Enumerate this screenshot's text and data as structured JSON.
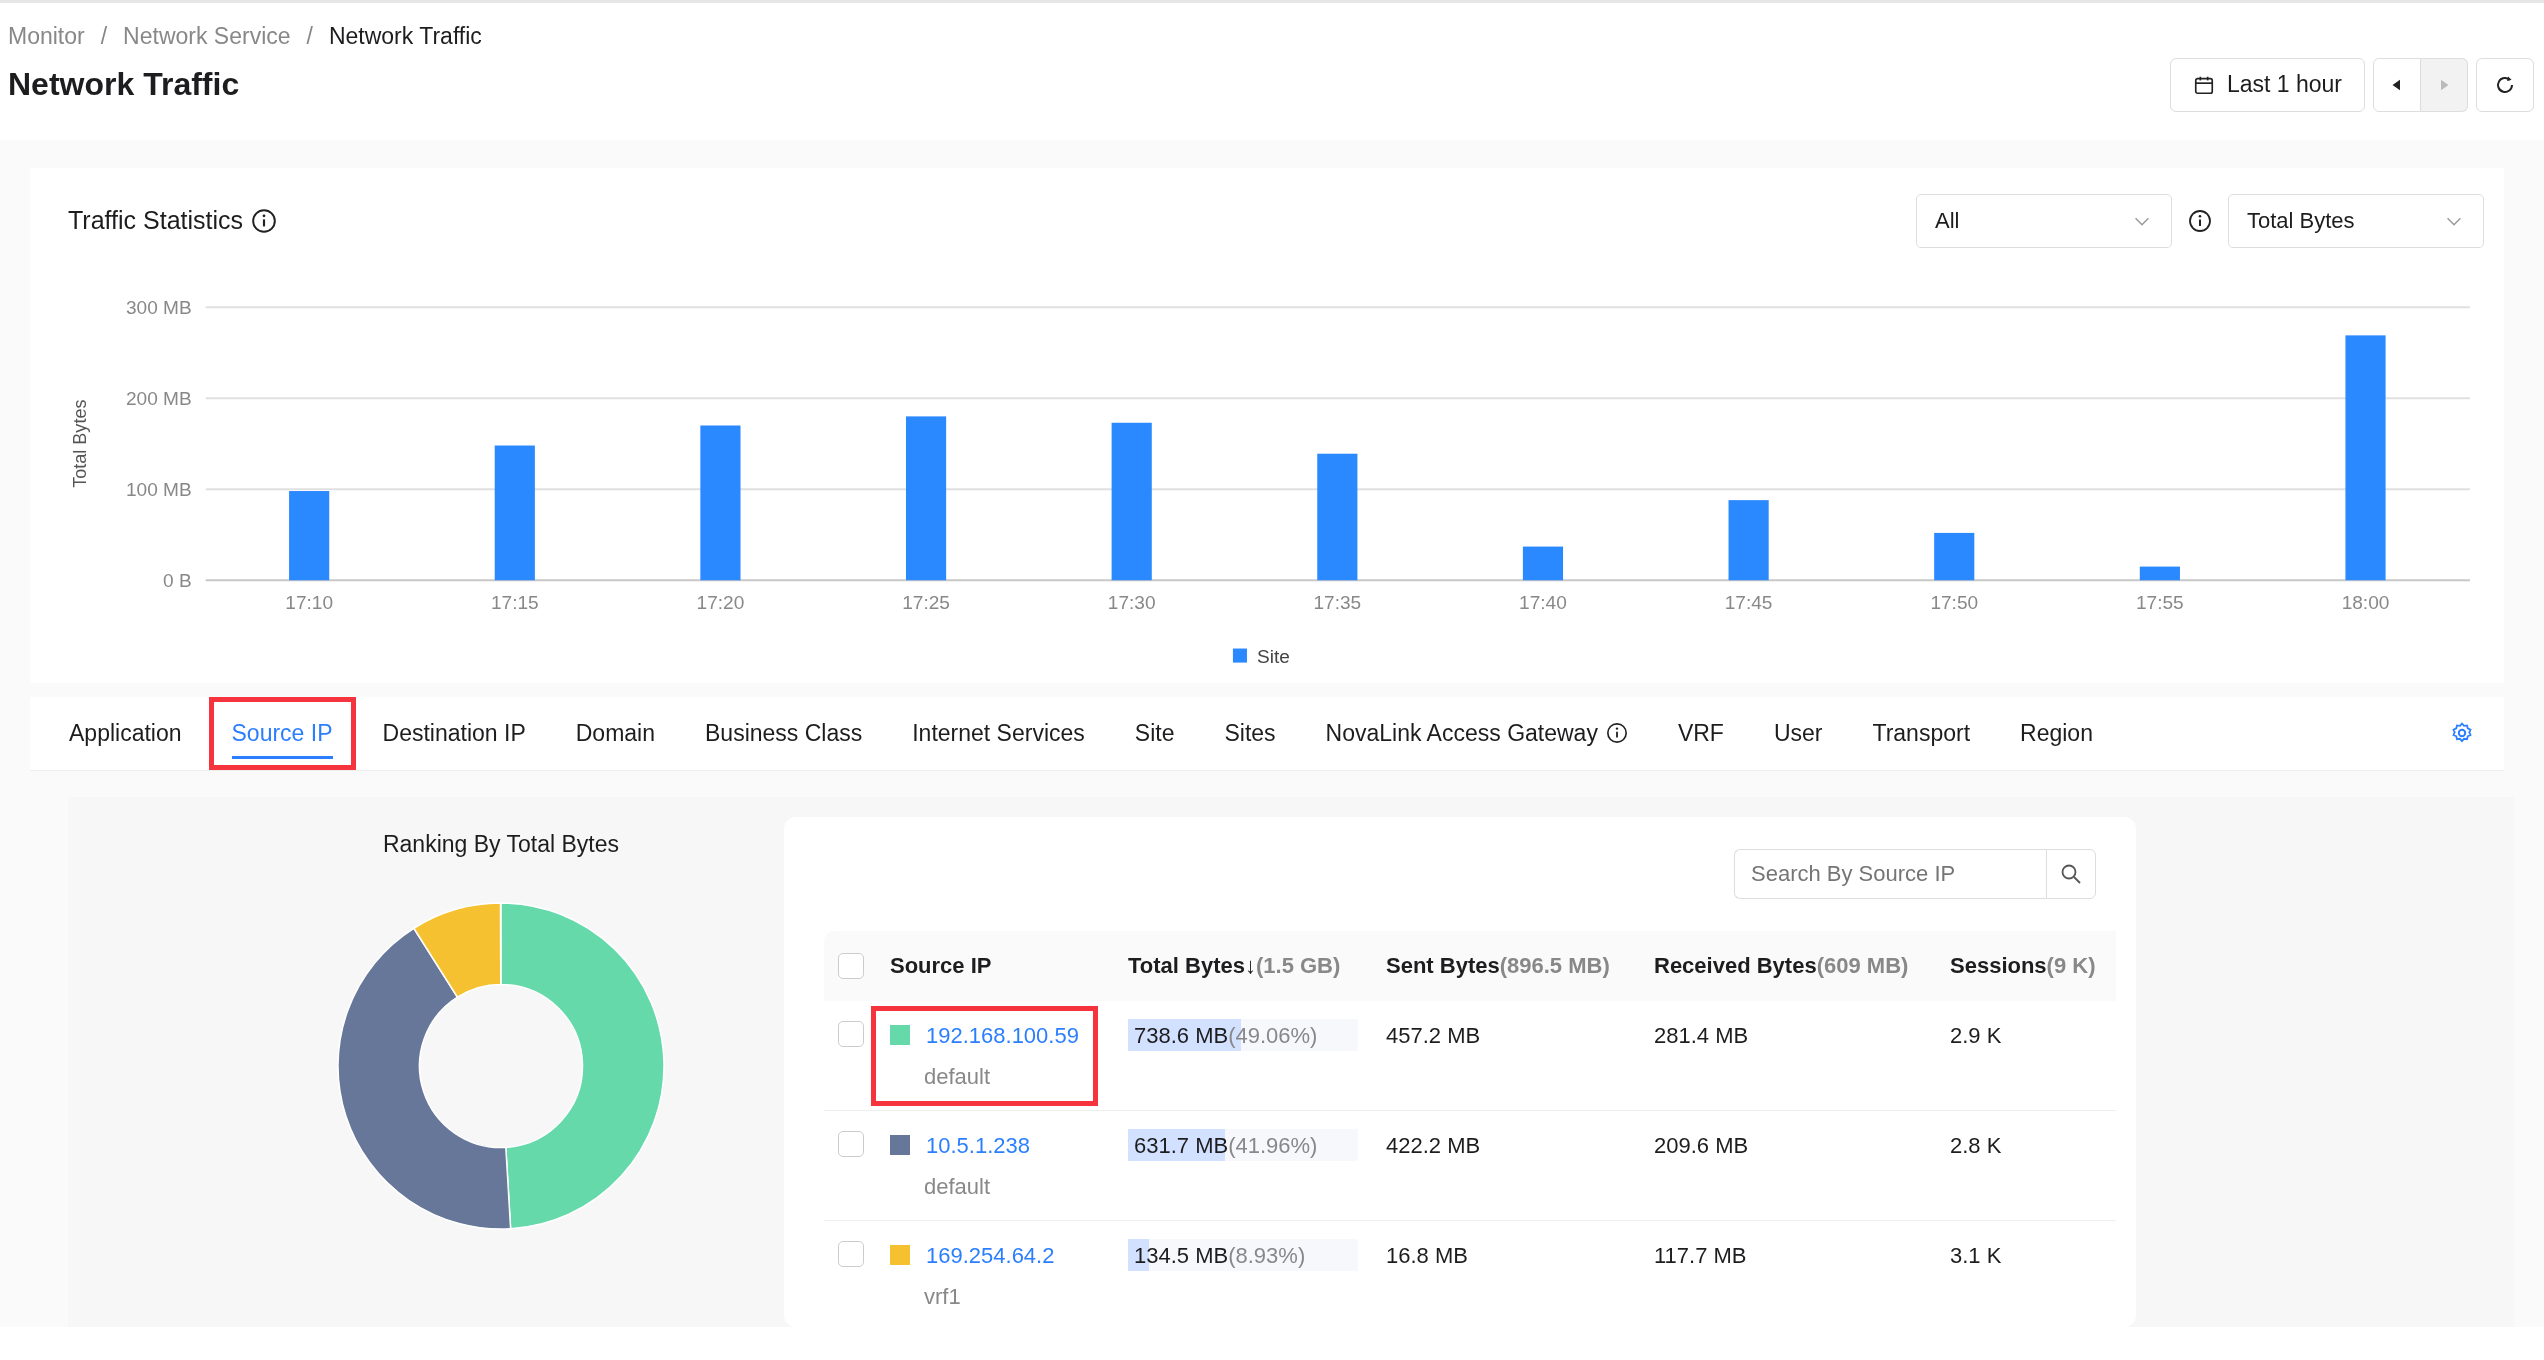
{
  "breadcrumb": [
    {
      "label": "Monitor",
      "current": false
    },
    {
      "label": "Network Service",
      "current": false
    },
    {
      "label": "Network Traffic",
      "current": true
    }
  ],
  "separator": "/",
  "title": "Network Traffic",
  "time_controls": {
    "range": "Last 1 hour",
    "prev_disabled": false,
    "next_disabled": true
  },
  "traffic_statistics": {
    "title": "Traffic Statistics",
    "filter": "All",
    "metric": "Total Bytes",
    "chart_data": {
      "type": "bar",
      "ylabel": "Total Bytes",
      "categories": [
        "17:10",
        "17:15",
        "17:20",
        "17:25",
        "17:30",
        "17:35",
        "17:40",
        "17:45",
        "17:50",
        "17:55",
        "18:00"
      ],
      "series": [
        {
          "name": "Site",
          "color": "#2b89ff",
          "values": [
            98,
            148,
            170,
            180,
            173,
            139,
            37,
            88,
            52,
            15,
            269
          ]
        }
      ],
      "ylim": [
        0,
        300
      ],
      "yticks": [
        {
          "value": 0,
          "label": "0 B"
        },
        {
          "value": 100,
          "label": "100 MB"
        },
        {
          "value": 200,
          "label": "200 MB"
        },
        {
          "value": 300,
          "label": "300 MB"
        }
      ]
    }
  },
  "tabs": [
    {
      "label": "Application",
      "selected": false,
      "info": false,
      "highlighted": false
    },
    {
      "label": "Source IP",
      "selected": true,
      "info": false,
      "highlighted": true
    },
    {
      "label": "Destination IP",
      "selected": false,
      "info": false,
      "highlighted": false
    },
    {
      "label": "Domain",
      "selected": false,
      "info": false,
      "highlighted": false
    },
    {
      "label": "Business Class",
      "selected": false,
      "info": false,
      "highlighted": false
    },
    {
      "label": "Internet Services",
      "selected": false,
      "info": false,
      "highlighted": false
    },
    {
      "label": "Site",
      "selected": false,
      "info": false,
      "highlighted": false
    },
    {
      "label": "Sites",
      "selected": false,
      "info": false,
      "highlighted": false
    },
    {
      "label": "NovaLink Access Gateway",
      "selected": false,
      "info": true,
      "highlighted": false
    },
    {
      "label": "VRF",
      "selected": false,
      "info": false,
      "highlighted": false
    },
    {
      "label": "User",
      "selected": false,
      "info": false,
      "highlighted": false
    },
    {
      "label": "Transport",
      "selected": false,
      "info": false,
      "highlighted": false
    },
    {
      "label": "Region",
      "selected": false,
      "info": false,
      "highlighted": false
    }
  ],
  "ranking": {
    "title": "Ranking By Total Bytes",
    "chart_data": {
      "type": "donut",
      "values": [
        49.06,
        41.96,
        8.93
      ]
    }
  },
  "table": {
    "search": {
      "placeholder": "Search By Source IP"
    },
    "select_all_checked": false,
    "columns": [
      {
        "label": "Source IP"
      },
      {
        "label": "Total Bytes",
        "sort": "↓",
        "total": "(1.5 GB)"
      },
      {
        "label": "Sent Bytes",
        "total": "(896.5 MB)"
      },
      {
        "label": "Received Bytes",
        "total": "(609 MB)"
      },
      {
        "label": "Sessions",
        "total": "(9 K)"
      }
    ],
    "rows": [
      {
        "checked": false,
        "color": "#66d9ab",
        "ip": "192.168.100.59",
        "vrf": "default",
        "highlighted": true,
        "total": "738.6 MB",
        "share": "(49.06%)",
        "level": 0.49,
        "sent": "457.2 MB",
        "received": "281.4 MB",
        "sessions": "2.9 K"
      },
      {
        "checked": false,
        "color": "#667799",
        "ip": "10.5.1.238",
        "vrf": "default",
        "highlighted": false,
        "total": "631.7 MB",
        "share": "(41.96%)",
        "level": 0.42,
        "sent": "422.2 MB",
        "received": "209.6 MB",
        "sessions": "2.8 K"
      },
      {
        "checked": false,
        "color": "#f6c131",
        "ip": "169.254.64.2",
        "vrf": "vrf1",
        "highlighted": false,
        "total": "134.5 MB",
        "share": "(8.93%)",
        "level": 0.09,
        "sent": "16.8 MB",
        "received": "117.7 MB",
        "sessions": "3.1 K"
      }
    ]
  }
}
